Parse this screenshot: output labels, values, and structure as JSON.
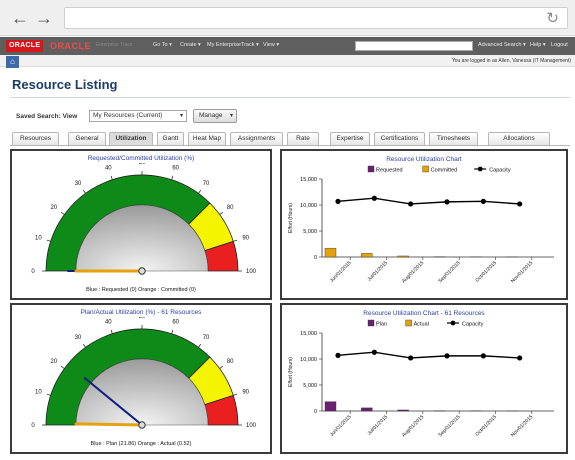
{
  "browser": {
    "url": "",
    "reload_icon": "↻",
    "back_icon": "←",
    "forward_icon": "→"
  },
  "header": {
    "oracle_logo": "ORACLE",
    "oracle_logo_2": "ORACLE",
    "product": "Enterprise Track",
    "menu": [
      "Go To ▾",
      "Create ▾",
      "My EnterpriseTrack ▾",
      "View ▾"
    ],
    "right_links": [
      "Advanced Search ▾",
      "Help ▾",
      "Logout"
    ],
    "logged_in": "You are logged in as Allen, Vanessa (IT Management)"
  },
  "page": {
    "title": "Resource Listing"
  },
  "saved_search": {
    "label": "Saved Search:  View",
    "value": "My Resources (Current)",
    "manage": "Manage"
  },
  "tabs": [
    "Resources",
    "General",
    "Utilization",
    "Gantt",
    "Heat Map",
    "Assignments",
    "Rate",
    "Expertise",
    "Certifications",
    "Timesheets",
    "Allocations"
  ],
  "active_tab": "Utilization",
  "colors": {
    "green": "#0e8a18",
    "yellow": "#f4f400",
    "red": "#ea1f1f",
    "navy": "#0e1f86",
    "orange": "#e6a10e",
    "purple": "#6b2170"
  },
  "gauges": [
    {
      "title": "Requested/Committed Utilization (%)",
      "ticks": [
        "0",
        "10",
        "20",
        "30",
        "40",
        "50",
        "60",
        "70",
        "80",
        "90",
        "100"
      ],
      "needle_blue": 0,
      "needle_orange": 0,
      "caption": "Blue : Requested (0) Orange : Committed (0)"
    },
    {
      "title": "Plan/Actual Utilization (%)   - 61 Resources",
      "ticks": [
        "0",
        "10",
        "20",
        "30",
        "40",
        "50",
        "60",
        "70",
        "80",
        "90",
        "100"
      ],
      "needle_blue": 21.86,
      "needle_orange": 0.52,
      "caption": "Blue : Plan (21.86) Orange : Actual (0.52)"
    }
  ],
  "chart_data": [
    {
      "type": "bar",
      "title": "Resource Utilization Chart",
      "legend": [
        "Requested",
        "Committed",
        "Capacity"
      ],
      "ylabel": "Effort (Hours)",
      "yticks": [
        "15,000",
        "10,000",
        "5,000",
        "0"
      ],
      "ylim": [
        0,
        15000
      ],
      "categories": [
        "Jun/01/2015",
        "Jul/01/2015",
        "Aug/01/2015",
        "Sep/01/2015",
        "Oct/01/2015",
        "Nov/01/2015"
      ],
      "series": [
        {
          "name": "Requested",
          "values": [
            0,
            0,
            0,
            0,
            0,
            0
          ]
        },
        {
          "name": "Committed",
          "values": [
            1700,
            700,
            200,
            60,
            30,
            20
          ]
        },
        {
          "name": "Capacity",
          "values": [
            10700,
            11300,
            10200,
            10600,
            10700,
            10200
          ]
        }
      ]
    },
    {
      "type": "bar",
      "title": "Resource Utilization Chart   - 61 Resources",
      "legend": [
        "Plan",
        "Actual",
        "Capacity"
      ],
      "ylabel": "Effort (Hours)",
      "yticks": [
        "15,000",
        "10,000",
        "5,000",
        "0"
      ],
      "ylim": [
        0,
        15000
      ],
      "categories": [
        "Jun/01/2015",
        "Jul/01/2015",
        "Aug/01/2015",
        "Sep/01/2015",
        "Oct/01/2015",
        "Nov/01/2015"
      ],
      "series": [
        {
          "name": "Plan",
          "values": [
            1800,
            600,
            200,
            60,
            40,
            20
          ]
        },
        {
          "name": "Actual",
          "values": [
            0,
            0,
            0,
            0,
            0,
            0
          ]
        },
        {
          "name": "Capacity",
          "values": [
            10700,
            11300,
            10200,
            10600,
            10600,
            10200
          ]
        }
      ]
    }
  ]
}
